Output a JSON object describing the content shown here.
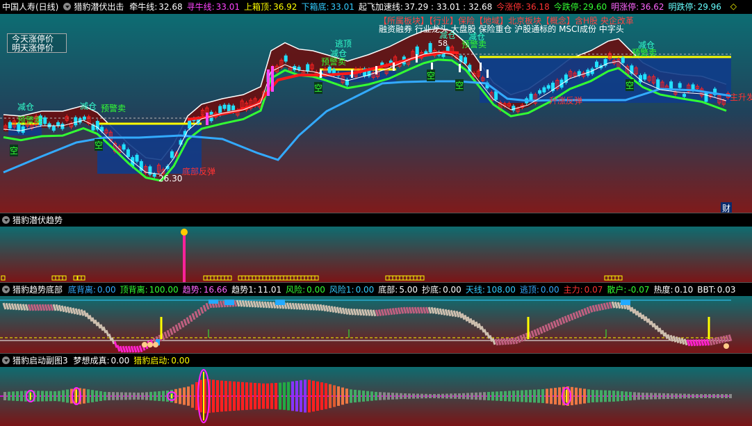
{
  "header": {
    "stock_name": "中国人寿(日线)",
    "indicator": "猎豹潜伏出击",
    "items": [
      {
        "label": "牵牛线:",
        "value": "32.68",
        "color": "#ffffff"
      },
      {
        "label": "寻牛线:",
        "value": "33.01",
        "color": "#ff44ff"
      },
      {
        "label": "上箱顶:",
        "value": "36.92",
        "color": "#ffff00"
      },
      {
        "label": "下箱底:",
        "value": "33.01",
        "color": "#33ccff"
      },
      {
        "label": "起飞加速线:",
        "value": "37.29 : 33.01 : 32.68",
        "color": "#ffffff"
      },
      {
        "label": "今涨停:",
        "value": "36.18",
        "color": "#ff3333"
      },
      {
        "label": "今跌停:",
        "value": "29.60",
        "color": "#33ff33"
      },
      {
        "label": "明涨停:",
        "value": "36.62",
        "color": "#ff66ff"
      },
      {
        "label": "明跌停:",
        "value": "29.96",
        "color": "#66ffff"
      }
    ],
    "diamond": "◇"
  },
  "main": {
    "legend": [
      "今天涨停价",
      "明天涨停价"
    ],
    "sector_text": "【所属板块】【行业】保险【地域】北京板块【概念】含H股 央企改革",
    "concept_text": "融资融券 行业龙头 大盘股 保险重仓 沪股通标的 MSCI成份 中字头",
    "low_label": "26.30",
    "high_label": "58",
    "annotations": [
      {
        "text": "减仓",
        "color": "#33ffcc"
      },
      {
        "text": "预警卖",
        "color": "#33ff33"
      },
      {
        "text": "空",
        "color": "#33ff33"
      },
      {
        "text": "逃顶",
        "color": "#33ffcc"
      },
      {
        "text": "底部反弹",
        "color": "#ff3333"
      },
      {
        "text": "升涨反弹",
        "color": "#ff3333"
      },
      {
        "text": "主升发动",
        "color": "#ff3333"
      }
    ],
    "finance_label": "财"
  },
  "panel2": {
    "title": "猎豹潜伏趋势"
  },
  "panel3": {
    "title": "猎豹趋势底部",
    "items": [
      {
        "label": "底背离:",
        "value": "0.00",
        "color": "#33aaff"
      },
      {
        "label": "顶背离:",
        "value": "100.00",
        "color": "#33ff33"
      },
      {
        "label": "趋势:",
        "value": "16.66",
        "color": "#ff66ff"
      },
      {
        "label": "趋势1:",
        "value": "11.01",
        "color": "#ffffff"
      },
      {
        "label": "风险:",
        "value": "0.00",
        "color": "#33ff33"
      },
      {
        "label": "风险1:",
        "value": "0.00",
        "color": "#33ccff"
      },
      {
        "label": "底部:",
        "value": "5.00",
        "color": "#ffffff"
      },
      {
        "label": "抄底:",
        "value": "0.00",
        "color": "#ffffff"
      },
      {
        "label": "天线:",
        "value": "108.00",
        "color": "#33ccff"
      },
      {
        "label": "逃顶:",
        "value": "0.00",
        "color": "#33aaff"
      },
      {
        "label": "主力:",
        "value": "0.07",
        "color": "#ff3333"
      },
      {
        "label": "散户:",
        "value": "-0.07",
        "color": "#33ff33"
      },
      {
        "label": "热度:",
        "value": "0.10",
        "color": "#ffffff"
      },
      {
        "label": "BBT:",
        "value": "0.03",
        "color": "#ffffff"
      }
    ]
  },
  "panel4": {
    "title": "猎豹启动副图3",
    "items": [
      {
        "label": "梦想成真:",
        "value": "0.00",
        "color": "#ffffff"
      },
      {
        "label": "猎豹启动:",
        "value": "0.00",
        "color": "#ffff00"
      }
    ]
  },
  "colors": {
    "up": "#ff2222",
    "down": "#22e0ff",
    "ma_red": "#ff1a1a",
    "ma_green": "#33ff33",
    "ma_blue": "#33aaff",
    "box_top": "#ffff00",
    "box_fill": "#103c8a"
  }
}
